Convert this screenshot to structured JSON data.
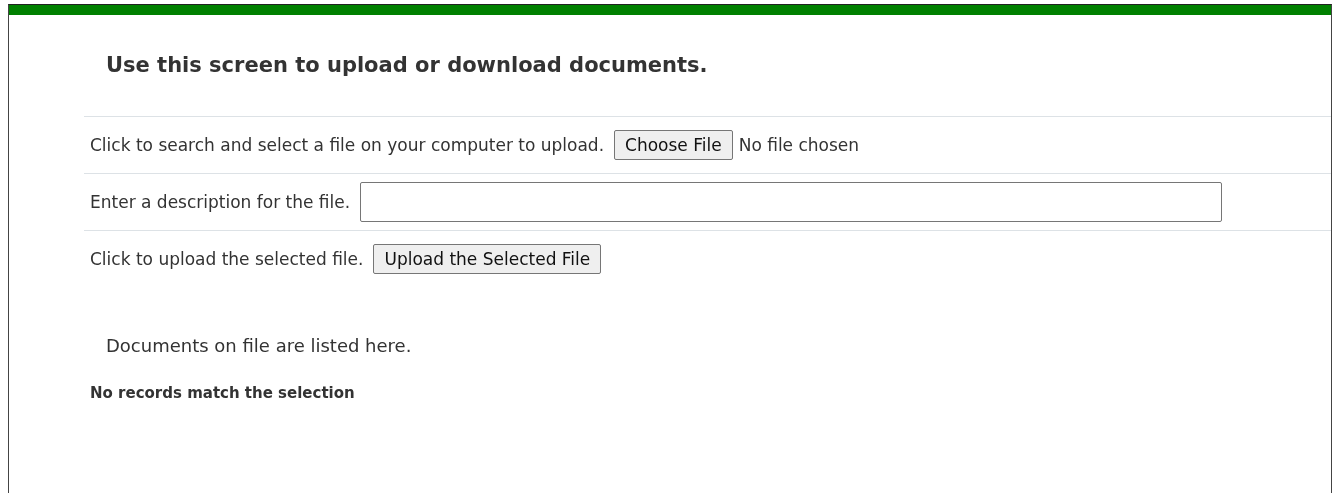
{
  "heading": "Use this screen to upload or download documents.",
  "form_rows": [
    {
      "kind": "file",
      "label": "Click to search and select a file on your computer to upload.",
      "button": "Choose File",
      "status": "No file chosen"
    },
    {
      "kind": "text",
      "label": "Enter a description for the file."
    },
    {
      "kind": "submit",
      "label": "Click to upload the selected file.",
      "button": "Upload the Selected File"
    }
  ],
  "documents": {
    "heading": "Documents on file are listed here.",
    "empty_message": "No records match the selection"
  }
}
